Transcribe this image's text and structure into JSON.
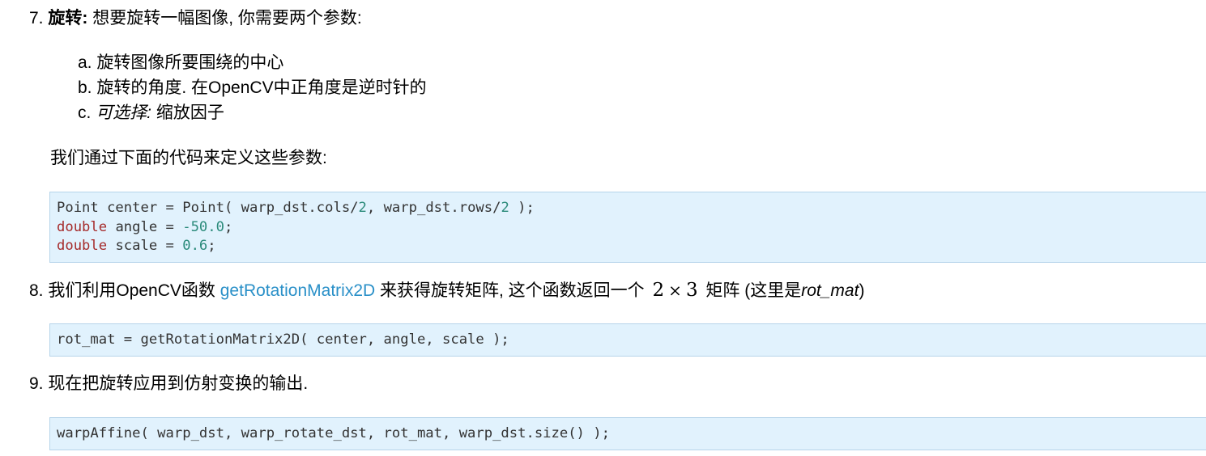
{
  "step7": {
    "number": "7.",
    "title": "旋转:",
    "text": "想要旋转一幅图像, 你需要两个参数:",
    "items": [
      {
        "marker": "a.",
        "text": "旋转图像所要围绕的中心"
      },
      {
        "marker": "b.",
        "text": "旋转的角度. 在OpenCV中正角度是逆时针的"
      },
      {
        "marker": "c.",
        "italic": "可选择:",
        "text": "缩放因子"
      }
    ],
    "followup": "我们通过下面的代码来定义这些参数:",
    "code": {
      "line1": {
        "a": "Point center = Point( warp_dst.cols/",
        "n1": "2",
        "b": ", warp_dst.rows/",
        "n2": "2",
        "c": " );"
      },
      "line2": {
        "kw": "double",
        "a": " angle = ",
        "n": "-50.0",
        "b": ";"
      },
      "line3": {
        "kw": "double",
        "a": " scale = ",
        "n": "0.6",
        "b": ";"
      }
    }
  },
  "step8": {
    "number": "8.",
    "text_before": "我们利用OpenCV函数",
    "link": "getRotationMatrix2D",
    "text_mid": "来获得旋转矩阵, 这个函数返回一个",
    "math_a": "2",
    "math_op": "×",
    "math_b": "3",
    "text_after": "矩阵 (这里是",
    "italic": "rot_mat",
    "close": ")",
    "code": "rot_mat = getRotationMatrix2D( center, angle, scale );"
  },
  "step9": {
    "number": "9.",
    "text": "现在把旋转应用到仿射变换的输出.",
    "code": "warpAffine( warp_dst, warp_rotate_dst, rot_mat, warp_dst.size() );"
  },
  "colors": {
    "link": "#2a90c8",
    "code_bg": "#e1f2fd",
    "code_border": "#b6d4ea",
    "keyword": "#a52a2a",
    "number": "#2a8a7a"
  }
}
